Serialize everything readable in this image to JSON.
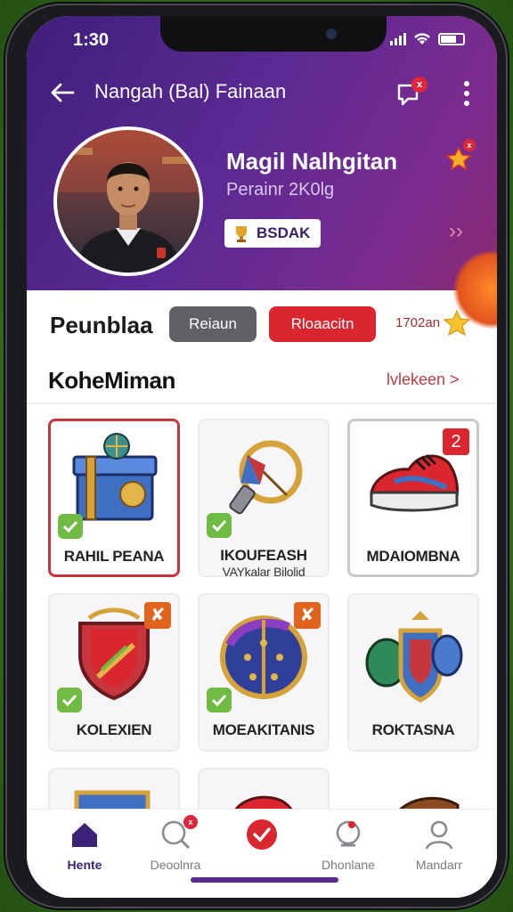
{
  "status_bar": {
    "time": "1:30"
  },
  "topbar": {
    "title": "Nangah (Bal) Fainaan",
    "chat_badge": "x"
  },
  "profile": {
    "name": "Magil Nalhgitan",
    "subtitle": "Perainr 2K0lg",
    "rank_badge": "BSDAK",
    "star_badge": "x"
  },
  "filter": {
    "label": "Peunblaa",
    "grey_button": "Reiaun",
    "red_button": "Rloaacitn",
    "score": "1702an"
  },
  "collection": {
    "title": "KoheMiman",
    "see_all": "lvlekeen >"
  },
  "items": [
    {
      "label": "RAHIL PEANA",
      "sublabel": "",
      "checked": true,
      "badge": "",
      "icon": "treasure-box-icon"
    },
    {
      "label": "IKOUFEASH",
      "sublabel": "VAYkalar Bilolid",
      "checked": true,
      "badge": "",
      "icon": "torch-emblem-icon"
    },
    {
      "label": "MDAIOMBNA",
      "sublabel": "",
      "checked": false,
      "badge": "2",
      "icon": "sneaker-icon"
    },
    {
      "label": "KOLEXIEN",
      "sublabel": "",
      "checked": true,
      "badge": "✘",
      "icon": "shield-crest-icon"
    },
    {
      "label": "MOEAKITANIS",
      "sublabel": "",
      "checked": true,
      "badge": "✘",
      "icon": "armor-shield-icon"
    },
    {
      "label": "ROKTASNA",
      "sublabel": "",
      "checked": false,
      "badge": "",
      "icon": "armor-gauntlet-icon"
    }
  ],
  "bottom_nav": [
    {
      "label": "Hente",
      "icon": "home-icon",
      "active": true
    },
    {
      "label": "Deoolnra",
      "icon": "search-icon",
      "active": false
    },
    {
      "label": "",
      "icon": "check-circle-icon",
      "active": false
    },
    {
      "label": "Dhonlane",
      "icon": "notification-icon",
      "active": false
    },
    {
      "label": "Mandarr",
      "icon": "profile-icon",
      "active": false
    }
  ],
  "colors": {
    "hero_start": "#3f1f7a",
    "hero_end": "#8a2a6f",
    "accent_red": "#d9262f",
    "accent_purple": "#3c2277",
    "check_green": "#6fbb43",
    "badge_orange": "#e0641e"
  }
}
